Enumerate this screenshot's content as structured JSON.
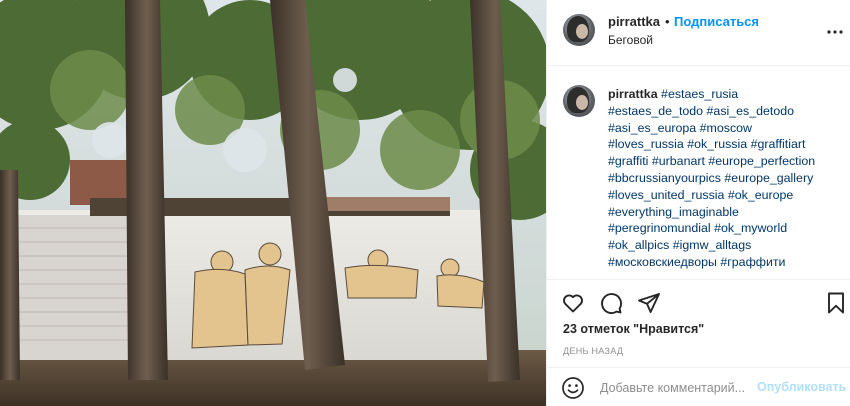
{
  "post": {
    "username": "pirrattka",
    "separator": "•",
    "follow_label": "Подписаться",
    "location": "Беговой",
    "more_icon": "more-options-icon"
  },
  "caption": {
    "username": "pirrattka",
    "lines": [
      [
        "#estaes_rusia"
      ],
      [
        "#estaes_de_todo",
        "#asi_es_detodo"
      ],
      [
        "#asi_es_europa",
        "#moscow"
      ],
      [
        "#loves_russia",
        "#ok_russia",
        "#graffitiart"
      ],
      [
        "#graffiti",
        "#urbanart",
        "#europe_perfection"
      ],
      [
        "#bbcrussianyourpics",
        "#europe_gallery"
      ],
      [
        "#loves_united_russia",
        "#ok_europe"
      ],
      [
        "#everything_imaginable"
      ],
      [
        "#peregrinomundial",
        "#ok_myworld"
      ],
      [
        "#ok_allpics",
        "#igmw_alltags"
      ],
      [
        "#московскиедворы",
        "#граффити"
      ]
    ]
  },
  "actions": {
    "icons": [
      "heart-icon",
      "comment-icon",
      "share-icon",
      "bookmark-icon"
    ],
    "likes_text": "23 отметок \"Нравится\"",
    "date": "ДЕНЬ НАЗАД"
  },
  "comment": {
    "placeholder": "Добавьте комментарий...",
    "publish_label": "Опубликовать",
    "icon": "emoji-icon"
  },
  "colors": {
    "link_blue": "#0095f6",
    "hashtag": "#00376b",
    "publish_disabled": "#b2dffc",
    "muted": "#8e8e8e",
    "divider": "#efefef"
  }
}
